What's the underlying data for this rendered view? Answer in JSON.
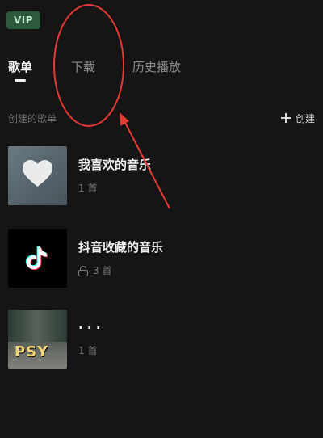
{
  "header": {
    "vip_label": "VIP"
  },
  "tabs": [
    {
      "label": "歌单",
      "active": true
    },
    {
      "label": "下载",
      "active": false
    },
    {
      "label": "历史播放",
      "active": false
    }
  ],
  "section": {
    "title": "创建的歌单",
    "create_label": "创建"
  },
  "playlists": [
    {
      "title": "我喜欢的音乐",
      "subtitle": "1 首",
      "cover_icon": "heart-icon"
    },
    {
      "title": "抖音收藏的音乐",
      "subtitle": "3 首",
      "cover_icon": "tiktok-icon",
      "locked": true
    },
    {
      "title": "· · ·",
      "subtitle": "1 首",
      "cover_icon": "album-cover",
      "album_text": "PSY"
    }
  ],
  "colors": {
    "background": "#151515",
    "vip_bg": "#2a5a3b",
    "annotation_red": "#e23a36"
  }
}
